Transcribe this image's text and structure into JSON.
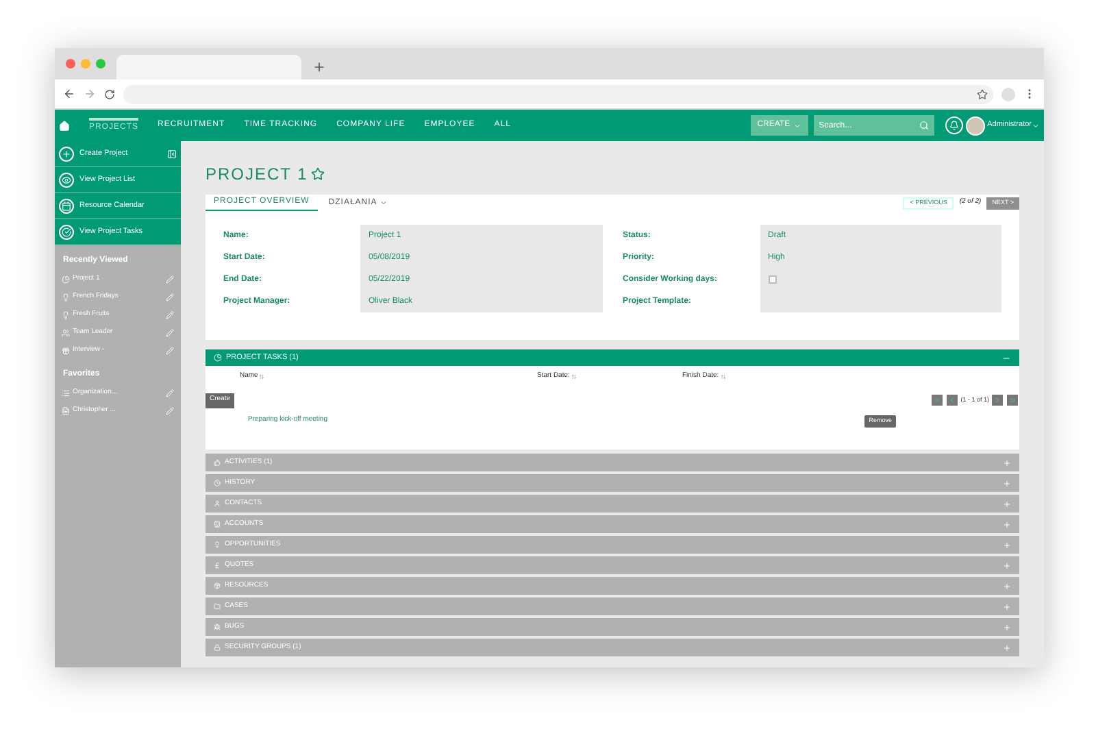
{
  "nav": {
    "items": [
      {
        "label": "PROJECTS",
        "selected": true
      },
      {
        "label": "RECRUITMENT",
        "selected": false
      },
      {
        "label": "TIME TRACKING",
        "selected": false
      },
      {
        "label": "COMPANY LIFE",
        "selected": false
      },
      {
        "label": "EMPLOYEE",
        "selected": false
      },
      {
        "label": "ALL",
        "selected": false
      }
    ],
    "create_button": "CREATE",
    "search": {
      "placeholder": "Search..."
    },
    "user": "Administrator"
  },
  "sidebar": {
    "actions": [
      {
        "label": "Create Project",
        "kind": "plus"
      },
      {
        "label": "View Project List",
        "kind": "eye"
      },
      {
        "label": "Resource Calendar",
        "kind": "calendar"
      },
      {
        "label": "View Project Tasks",
        "kind": "check"
      }
    ],
    "recently_viewed": {
      "title": "Recently Viewed",
      "items": [
        {
          "label": "Project 1",
          "kind": "pie"
        },
        {
          "label": "French Fridays",
          "kind": "bulb"
        },
        {
          "label": "Fresh Fruits",
          "kind": "bulb"
        },
        {
          "label": "Team Leader",
          "kind": "users"
        },
        {
          "label": "Interview -",
          "kind": "gift"
        }
      ]
    },
    "favorites": {
      "title": "Favorites",
      "items": [
        {
          "label": "Organization...",
          "kind": "list"
        },
        {
          "label": "Christopher ...",
          "kind": "file"
        }
      ]
    }
  },
  "title": "PROJECT 1",
  "starred": false,
  "detail": {
    "tabs": [
      {
        "label": "PROJECT OVERVIEW",
        "selected": true,
        "dropdown": false
      },
      {
        "label": "DZIAŁANIA",
        "selected": false,
        "dropdown": true
      }
    ],
    "pager": {
      "previous": "< PREVIOUS",
      "count": "(2 of 2)",
      "next": "NEXT >",
      "next_disabled": true
    },
    "left_fields": [
      {
        "label": "Name:",
        "kind": "text",
        "value": "Project 1"
      },
      {
        "label": "Start Date:",
        "kind": "text",
        "value": "05/08/2019"
      },
      {
        "label": "End Date:",
        "kind": "text",
        "value": "05/22/2019"
      },
      {
        "label": "Project Manager:",
        "kind": "text",
        "value": "Oliver Black"
      }
    ],
    "right_fields": [
      {
        "label": "Status:",
        "kind": "text",
        "value": "Draft"
      },
      {
        "label": "Priority:",
        "kind": "text",
        "value": "High"
      },
      {
        "label": "Consider Working days:",
        "kind": "checkbox",
        "checked": false
      },
      {
        "label": "Project Template:",
        "kind": "text"
      }
    ]
  },
  "tasks": {
    "title": "PROJECT TASKS (1)",
    "expanded": true,
    "columns": [
      "Name",
      "Start Date:",
      "Finish Date:"
    ],
    "create_button": "Create",
    "pagination": "(1 - 1 of 1)",
    "rows": [
      {
        "name": "Preparing kick-off meeting",
        "action": "Remove"
      }
    ]
  },
  "subpanels": [
    {
      "title": "ACTIVITIES (1)",
      "kind": "activities",
      "expanded": false
    },
    {
      "title": "HISTORY",
      "kind": "history",
      "expanded": false
    },
    {
      "title": "CONTACTS",
      "kind": "contacts",
      "expanded": false
    },
    {
      "title": "ACCOUNTS",
      "kind": "accounts",
      "expanded": false
    },
    {
      "title": "OPPORTUNITIES",
      "kind": "opportunities",
      "expanded": false
    },
    {
      "title": "QUOTES",
      "kind": "quotes",
      "expanded": false
    },
    {
      "title": "RESOURCES",
      "kind": "resources",
      "expanded": false
    },
    {
      "title": "CASES",
      "kind": "cases",
      "expanded": false
    },
    {
      "title": "BUGS",
      "kind": "bugs",
      "expanded": false
    },
    {
      "title": "SECURITY GROUPS (1)",
      "kind": "security",
      "expanded": false
    }
  ]
}
